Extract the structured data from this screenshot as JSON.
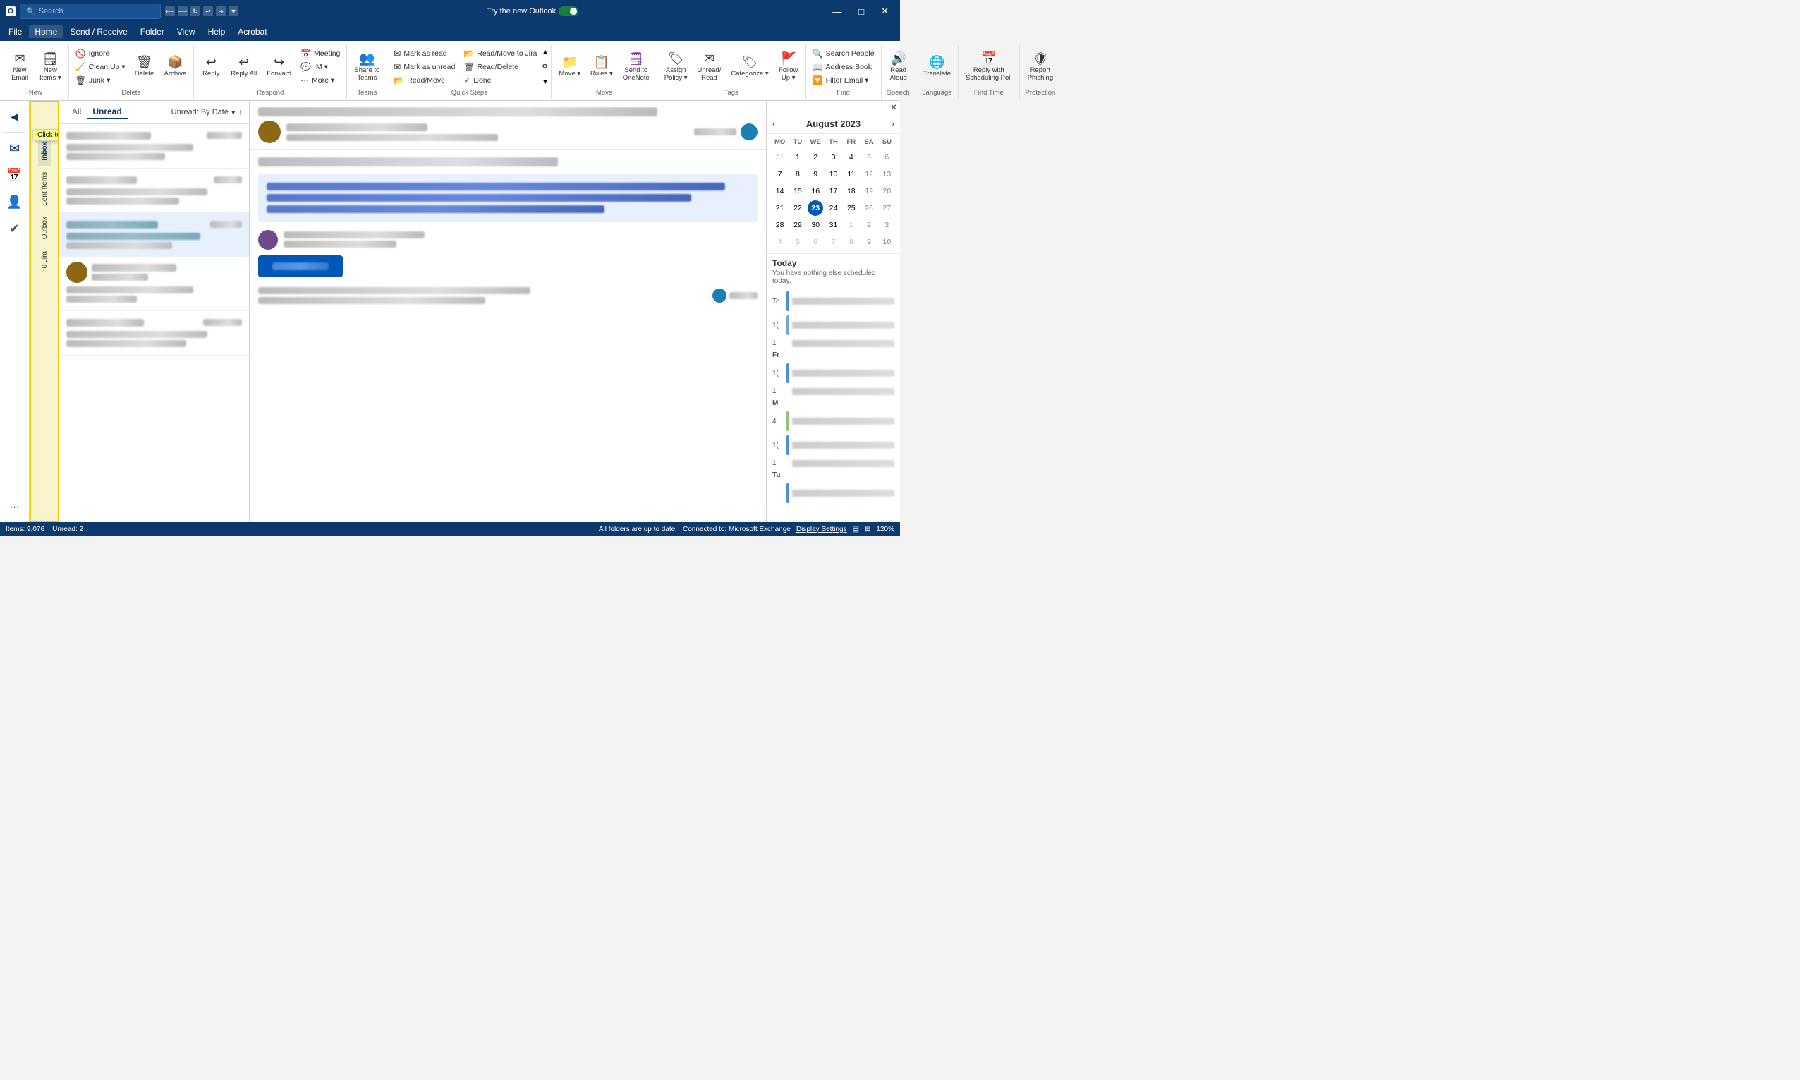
{
  "titleBar": {
    "searchPlaceholder": "Search",
    "tryNewLabel": "Try the new Outlook",
    "minBtn": "—",
    "maxBtn": "□",
    "closeBtn": "✕"
  },
  "menuBar": {
    "items": [
      "File",
      "Home",
      "Send / Receive",
      "Folder",
      "View",
      "Help",
      "Acrobat"
    ]
  },
  "ribbon": {
    "groups": [
      {
        "label": "New",
        "items": [
          {
            "id": "new-email",
            "icon": "✉",
            "label": "New\nEmail",
            "hasDropdown": false
          },
          {
            "id": "new-items",
            "icon": "📋",
            "label": "New\nItems",
            "hasDropdown": true
          }
        ]
      },
      {
        "label": "Delete",
        "items": [
          {
            "id": "ignore",
            "icon": "🚫",
            "label": "Ignore",
            "small": true
          },
          {
            "id": "clean-up",
            "icon": "🧹",
            "label": "Clean Up",
            "small": true,
            "hasDropdown": true
          },
          {
            "id": "junk",
            "icon": "📥",
            "label": "Junk",
            "small": true,
            "hasDropdown": true
          },
          {
            "id": "delete",
            "icon": "🗑",
            "label": "Delete",
            "big": true
          },
          {
            "id": "archive",
            "icon": "📦",
            "label": "Archive",
            "big": true
          }
        ]
      },
      {
        "label": "Respond",
        "items": [
          {
            "id": "reply",
            "icon": "↩",
            "label": "Reply",
            "big": true
          },
          {
            "id": "reply-all",
            "icon": "↩↩",
            "label": "Reply All",
            "big": true
          },
          {
            "id": "forward",
            "icon": "↪",
            "label": "Forward",
            "big": true
          },
          {
            "id": "meeting",
            "icon": "📅",
            "label": "Meeting",
            "small": true
          },
          {
            "id": "im",
            "icon": "💬",
            "label": "IM",
            "small": true,
            "hasDropdown": true
          },
          {
            "id": "more-respond",
            "icon": "…",
            "label": "More",
            "small": true,
            "hasDropdown": true
          }
        ]
      },
      {
        "label": "Teams",
        "items": [
          {
            "id": "share-to-teams",
            "icon": "👥",
            "label": "Share to\nTeams",
            "big": true
          }
        ]
      },
      {
        "label": "Quick Steps",
        "items": [
          {
            "id": "mark-as-read",
            "icon": "✉",
            "label": "Mark as read",
            "small": true
          },
          {
            "id": "mark-as-unread",
            "icon": "✉",
            "label": "Mark as unread",
            "small": true
          },
          {
            "id": "read-move",
            "icon": "📂",
            "label": "Read/Move",
            "small": true
          },
          {
            "id": "read-move-jira",
            "icon": "📂",
            "label": "Read/Move to Jira",
            "small": true
          },
          {
            "id": "read-delete",
            "icon": "🗑",
            "label": "Read/Delete",
            "small": true
          },
          {
            "id": "done",
            "icon": "✓",
            "label": "Done",
            "small": true
          }
        ]
      },
      {
        "label": "Move",
        "items": [
          {
            "id": "move",
            "icon": "📁",
            "label": "Move",
            "big": true,
            "hasDropdown": true
          },
          {
            "id": "rules",
            "icon": "📋",
            "label": "Rules",
            "big": true,
            "hasDropdown": true
          },
          {
            "id": "send-to-onenote",
            "icon": "🗒",
            "label": "Send to\nOneNote",
            "big": true
          }
        ]
      },
      {
        "label": "Tags",
        "items": [
          {
            "id": "assign-policy",
            "icon": "🏷",
            "label": "Assign\nPolicy",
            "big": true,
            "hasDropdown": true
          },
          {
            "id": "unread-read",
            "icon": "✉",
            "label": "Unread/\nRead",
            "big": true
          },
          {
            "id": "categorize",
            "icon": "🏷",
            "label": "Categorize",
            "big": true,
            "hasDropdown": true
          },
          {
            "id": "follow-up",
            "icon": "🚩",
            "label": "Follow\nUp",
            "big": true,
            "hasDropdown": true
          }
        ]
      },
      {
        "label": "Find",
        "items": [
          {
            "id": "search-people",
            "icon": "🔍",
            "label": "Search People",
            "small": true
          },
          {
            "id": "address-book",
            "icon": "📖",
            "label": "Address Book",
            "small": true
          },
          {
            "id": "filter-email",
            "icon": "🔽",
            "label": "Filter Email",
            "small": true,
            "hasDropdown": true
          }
        ]
      },
      {
        "label": "Speech",
        "items": [
          {
            "id": "read-aloud",
            "icon": "🔊",
            "label": "Read\nAloud",
            "big": true
          }
        ]
      },
      {
        "label": "Language",
        "items": [
          {
            "id": "translate",
            "icon": "🌐",
            "label": "Translate",
            "big": true
          }
        ]
      },
      {
        "label": "Find Time",
        "items": [
          {
            "id": "reply-scheduling-poll",
            "icon": "📅",
            "label": "Reply with\nScheduling Poll",
            "big": true
          }
        ]
      },
      {
        "label": "Protection",
        "items": [
          {
            "id": "report-phishing",
            "icon": "🛡",
            "label": "Report\nPhishing",
            "big": true
          }
        ]
      }
    ]
  },
  "emailList": {
    "tabs": [
      {
        "id": "all",
        "label": "All",
        "active": false
      },
      {
        "id": "unread",
        "label": "Unread",
        "active": true
      }
    ],
    "filter": "Unread: By Date",
    "emails": [
      {
        "id": "e1",
        "selected": false
      },
      {
        "id": "e2",
        "selected": false
      },
      {
        "id": "e3",
        "selected": true
      },
      {
        "id": "e4",
        "selected": false
      },
      {
        "id": "e5",
        "selected": false
      }
    ]
  },
  "folderPane": {
    "tooltip": "Click to expand Folder Pane",
    "items": [
      "Inbox",
      "Sent Items",
      "Outbox",
      "Jira"
    ]
  },
  "calendarPanel": {
    "title": "August 2023",
    "dayHeaders": [
      "MO",
      "TU",
      "WE",
      "TH",
      "FR",
      "SA",
      "SU"
    ],
    "weeks": [
      [
        {
          "day": 31,
          "otherMonth": true
        },
        {
          "day": 1,
          "otherMonth": false
        },
        {
          "day": 2,
          "otherMonth": false
        },
        {
          "day": 3,
          "otherMonth": false
        },
        {
          "day": 4,
          "otherMonth": false
        },
        {
          "day": 5,
          "otherMonth": false,
          "weekend": true
        },
        {
          "day": 6,
          "otherMonth": false,
          "weekend": true
        }
      ],
      [
        {
          "day": 7
        },
        {
          "day": 8
        },
        {
          "day": 9
        },
        {
          "day": 10
        },
        {
          "day": 11
        },
        {
          "day": 12,
          "weekend": true
        },
        {
          "day": 13,
          "weekend": true
        }
      ],
      [
        {
          "day": 14
        },
        {
          "day": 15
        },
        {
          "day": 16
        },
        {
          "day": 17
        },
        {
          "day": 18
        },
        {
          "day": 19,
          "weekend": true
        },
        {
          "day": 20,
          "weekend": true
        }
      ],
      [
        {
          "day": 21
        },
        {
          "day": 22
        },
        {
          "day": 23,
          "today": true
        },
        {
          "day": 24
        },
        {
          "day": 25
        },
        {
          "day": 26,
          "weekend": true
        },
        {
          "day": 27,
          "weekend": true
        }
      ],
      [
        {
          "day": 28
        },
        {
          "day": 29
        },
        {
          "day": 30
        },
        {
          "day": 31
        },
        {
          "day": 1,
          "otherMonth": true
        },
        {
          "day": 2,
          "otherMonth": true,
          "weekend": true
        },
        {
          "day": 3,
          "otherMonth": true,
          "weekend": true
        }
      ],
      [
        {
          "day": 4,
          "otherMonth": true
        },
        {
          "day": 5,
          "otherMonth": true
        },
        {
          "day": 6,
          "otherMonth": true
        },
        {
          "day": 7,
          "otherMonth": true
        },
        {
          "day": 8,
          "otherMonth": true
        },
        {
          "day": 9,
          "otherMonth": true,
          "weekend": true
        },
        {
          "day": 10,
          "otherMonth": true,
          "weekend": true
        }
      ]
    ],
    "todaySection": {
      "label": "Today",
      "message": "You have nothing else scheduled today."
    },
    "eventTimes": [
      "To",
      "1(",
      "1",
      "Fr",
      "1(",
      "1",
      "M",
      "4",
      "1(",
      "1",
      "Tu"
    ]
  },
  "navIcons": [
    {
      "id": "mail-nav",
      "icon": "✉",
      "active": true
    },
    {
      "id": "calendar-nav",
      "icon": "📅"
    },
    {
      "id": "people-nav",
      "icon": "👤"
    },
    {
      "id": "tasks-nav",
      "icon": "✔"
    },
    {
      "id": "more-nav",
      "icon": "···"
    }
  ],
  "statusBar": {
    "leftText": "Items: 9,076",
    "unreadText": "Unread: 2",
    "centerText": "All folders are up to date.",
    "connectionText": "Connected to: Microsoft Exchange",
    "displaySettings": "Display Settings",
    "zoom": "120%",
    "viewIcons": [
      "🖥",
      "📊"
    ]
  }
}
